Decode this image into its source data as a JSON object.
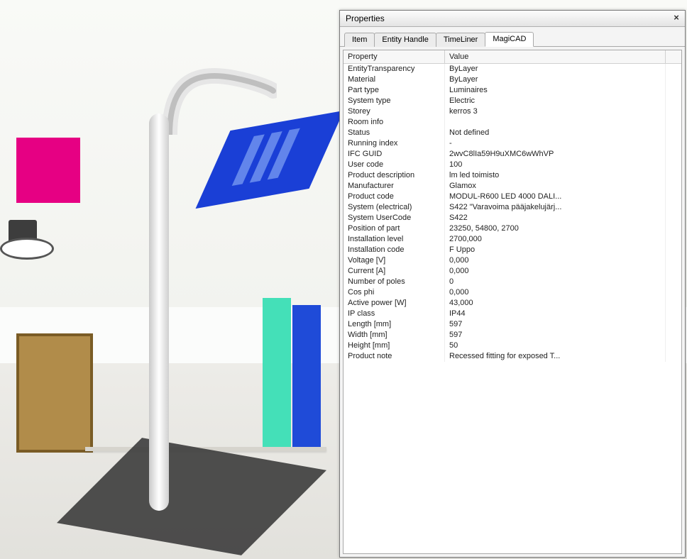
{
  "panel": {
    "title": "Properties",
    "close_glyph": "×",
    "tabs": [
      {
        "label": "Item"
      },
      {
        "label": "Entity Handle"
      },
      {
        "label": "TimeLiner"
      },
      {
        "label": "MagiCAD"
      }
    ],
    "active_tab_index": 3,
    "columns": {
      "property": "Property",
      "value": "Value"
    },
    "rows": [
      {
        "k": "EntityTransparency",
        "v": "ByLayer"
      },
      {
        "k": "Material",
        "v": "ByLayer"
      },
      {
        "k": "Part type",
        "v": "Luminaires"
      },
      {
        "k": "System type",
        "v": "Electric"
      },
      {
        "k": "Storey",
        "v": "kerros 3"
      },
      {
        "k": "Room info",
        "v": ""
      },
      {
        "k": "Status",
        "v": "Not defined"
      },
      {
        "k": "Running index",
        "v": "-"
      },
      {
        "k": "IFC GUID",
        "v": "2wvC8lIa59H9uXMC6wWhVP"
      },
      {
        "k": "User code",
        "v": "100"
      },
      {
        "k": "Product description",
        "v": "lm led toimisto"
      },
      {
        "k": "Manufacturer",
        "v": "Glamox"
      },
      {
        "k": "Product code",
        "v": "MODUL-R600 LED 4000 DALI..."
      },
      {
        "k": "System (electrical)",
        "v": "S422 \"Varavoima pääjakelujärj..."
      },
      {
        "k": "System UserCode",
        "v": "S422"
      },
      {
        "k": "Position of part",
        "v": "23250, 54800, 2700"
      },
      {
        "k": "Installation level",
        "v": "2700,000"
      },
      {
        "k": "Installation code",
        "v": "F Uppo"
      },
      {
        "k": "Voltage [V]",
        "v": "0,000"
      },
      {
        "k": "Current [A]",
        "v": "0,000"
      },
      {
        "k": "Number of poles",
        "v": "0"
      },
      {
        "k": "Cos phi",
        "v": "0,000"
      },
      {
        "k": "Active power [W]",
        "v": "43,000"
      },
      {
        "k": "IP class",
        "v": "IP44"
      },
      {
        "k": "Length [mm]",
        "v": "597"
      },
      {
        "k": "Width [mm]",
        "v": "597"
      },
      {
        "k": "Height [mm]",
        "v": "50"
      },
      {
        "k": "Product note",
        "v": "Recessed fitting for exposed T..."
      }
    ]
  }
}
